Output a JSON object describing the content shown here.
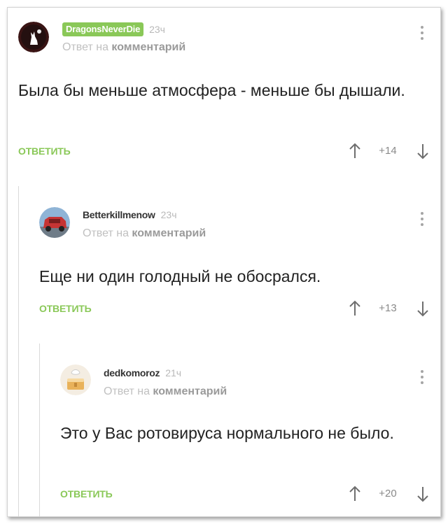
{
  "comments": [
    {
      "author": "DragonsNeverDie",
      "time": "23ч",
      "reply_label": "Ответ на",
      "reply_link": "комментарий",
      "text": "Была бы меньше атмосфера - меньше бы дышали.",
      "reply_button": "ОТВЕТИТЬ",
      "rating": "+14"
    },
    {
      "author": "Betterkillmenow",
      "time": "23ч",
      "reply_label": "Ответ на",
      "reply_link": "комментарий",
      "text": "Еще ни один голодный не обосрался.",
      "reply_button": "ОТВЕТИТЬ",
      "rating": "+13"
    },
    {
      "author": "dedkomoroz",
      "time": "21ч",
      "reply_label": "Ответ на",
      "reply_link": "комментарий",
      "text": "Это у Вас ротовируса нормального не было.",
      "reply_button": "ОТВЕТИТЬ",
      "rating": "+20"
    }
  ],
  "colors": {
    "accent_green": "#8ac858",
    "muted_text": "#c0c0c0",
    "body_text": "#222222"
  },
  "icons": [
    "avatar-wolf",
    "avatar-red-car",
    "avatar-cake",
    "more-vertical-icon",
    "arrow-up-icon",
    "arrow-down-icon"
  ]
}
